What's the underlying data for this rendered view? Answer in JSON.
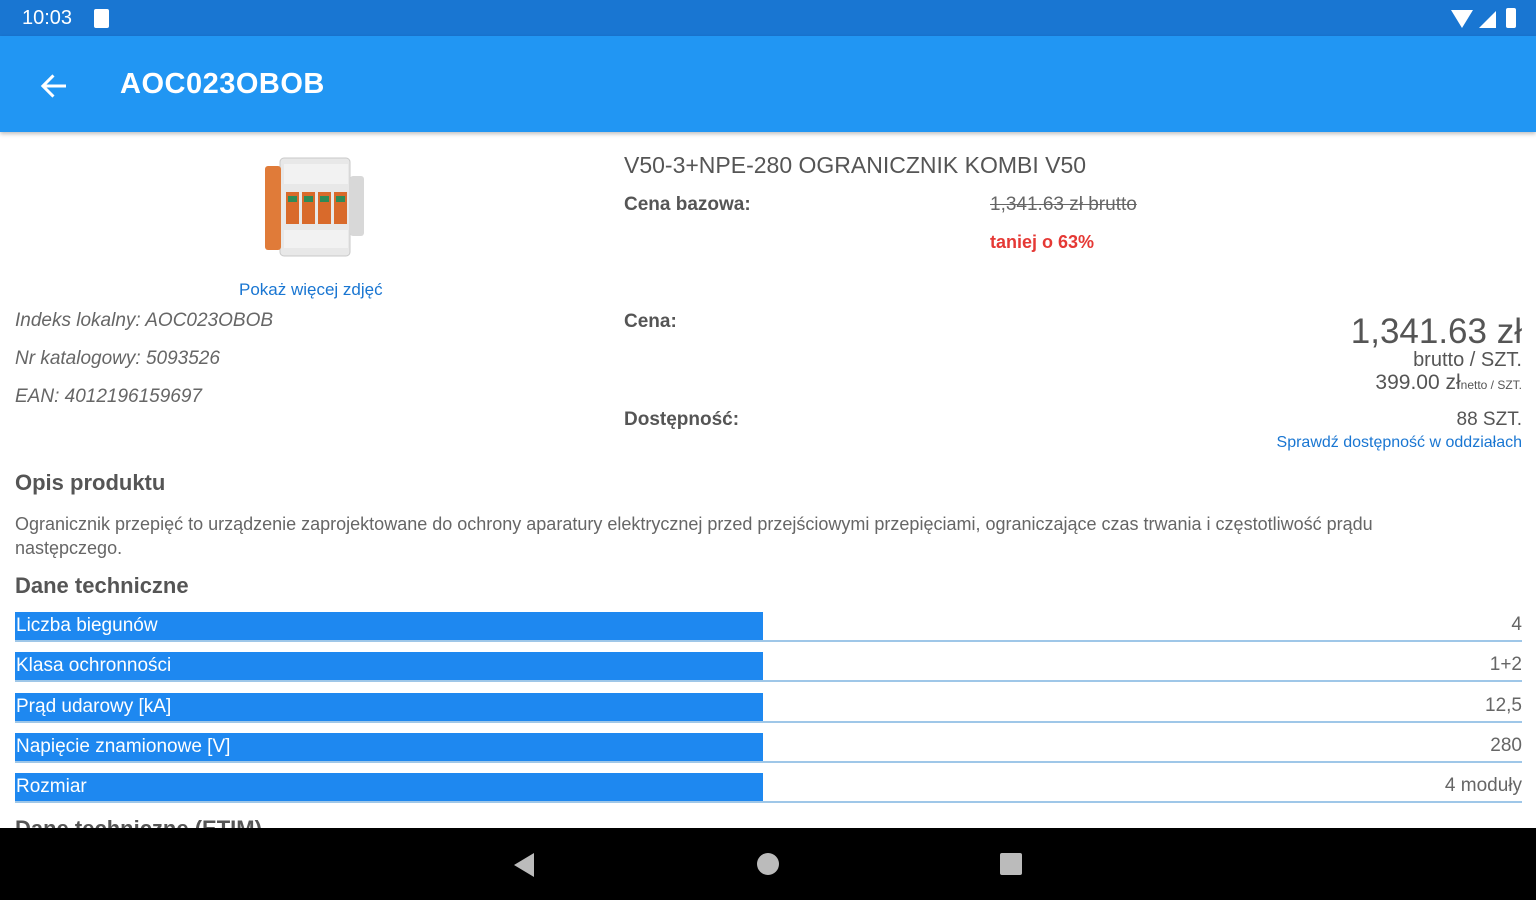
{
  "status_bar": {
    "time": "10:03"
  },
  "app_bar": {
    "title": "AOC023OBOB"
  },
  "product": {
    "more_photos_label": "Pokaż więcej zdjęć",
    "local_index": "Indeks lokalny: AOC023OBOB",
    "catalog_number": "Nr katalogowy: 5093526",
    "ean": "EAN: 4012196159697",
    "name": "V50-3+NPE-280 OGRANICZNIK KOMBI V50",
    "base_price_label": "Cena bazowa:",
    "base_price": "1,341.63 zł brutto",
    "discount": "taniej o 63%",
    "price_label": "Cena:",
    "price": "1,341.63 zł",
    "price_unit": "brutto / SZT.",
    "net_price": "399.00 zł",
    "net_unit": "netto / SZT.",
    "availability_label": "Dostępność:",
    "availability": "88 SZT.",
    "check_availability": "Sprawdź dostępność w oddziałach"
  },
  "description": {
    "title": "Opis produktu",
    "text": "Ogranicznik przepięć to urządzenie zaprojektowane do ochrony aparatury elektrycznej przed przejściowymi przepięciami, ograniczające czas trwania i częstotliwość prądu następczego."
  },
  "technical": {
    "title": "Dane techniczne",
    "rows": [
      {
        "name": "Liczba biegunów",
        "value": "4"
      },
      {
        "name": "Klasa ochronności",
        "value": "1+2"
      },
      {
        "name": "Prąd udarowy [kA]",
        "value": "12,5"
      },
      {
        "name": "Napięcie znamionowe [V]",
        "value": "280"
      },
      {
        "name": "Rozmiar",
        "value": "4 moduły"
      }
    ]
  },
  "etim": {
    "title": "Dane techniczne (ETIM)"
  }
}
